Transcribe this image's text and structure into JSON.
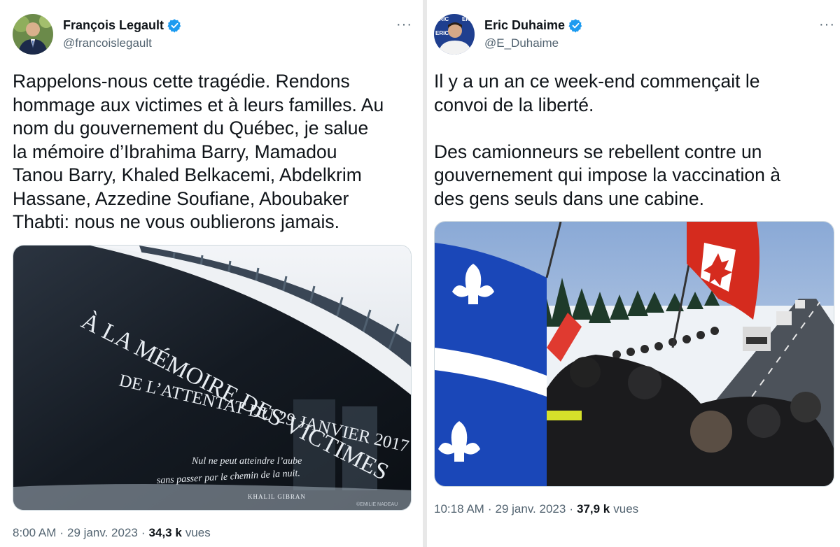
{
  "left_tweet": {
    "author_name": "François Legault",
    "handle": "@francoislegault",
    "more_label": "···",
    "text": "Rappelons-nous cette tragédie. Rendons\nhommage aux victimes et à leurs familles. Au\nnom du gouvernement du Québec, je salue\nla mémoire d’Ibrahima Barry, Mamadou\nTanou Barry, Khaled Belkacemi, Abdelkrim\nHassane, Azzedine Soufiane, Aboubaker\nThabti: nous ne vous oublierons jamais.",
    "image": {
      "inscription_line1": "À LA MÉMOIRE DES VICTIMES",
      "inscription_line2": "DE L’ATTENTAT DU 29 JANVIER 2017",
      "quote_line1": "Nul ne peut atteindre l’aube",
      "quote_line2": "sans passer par le chemin de la nuit.",
      "quote_author": "KHALIL GIBRAN",
      "watermark": "©EMILIE NADEAU"
    },
    "time": "8:00 AM",
    "sep1": "·",
    "date": "29 janv. 2023",
    "sep2": "·",
    "views_count": "34,3 k",
    "views_label": "vues"
  },
  "right_tweet": {
    "author_name": "Eric Duhaime",
    "handle": "@E_Duhaime",
    "more_label": "···",
    "text": "Il y a un an ce week-end commençait le\nconvoi de la liberté.\n\nDes camionneurs se rebellent contre un\ngouvernement qui impose la vaccination à\ndes gens seuls dans une cabine.",
    "avatar_banner": "ERIC",
    "time": "10:18 AM",
    "sep1": "·",
    "date": "29 janv. 2023",
    "sep2": "·",
    "views_count": "37,9 k",
    "views_label": "vues"
  },
  "colors": {
    "verified_blue": "#1d9bf0",
    "text_primary": "#0f1419",
    "text_secondary": "#536471",
    "quebec_blue": "#1a47b8",
    "canada_red": "#d52b1e"
  },
  "icons": [
    "verified-badge-icon",
    "more-options-icon",
    "fleur-de-lis-icon",
    "maple-leaf-icon"
  ]
}
